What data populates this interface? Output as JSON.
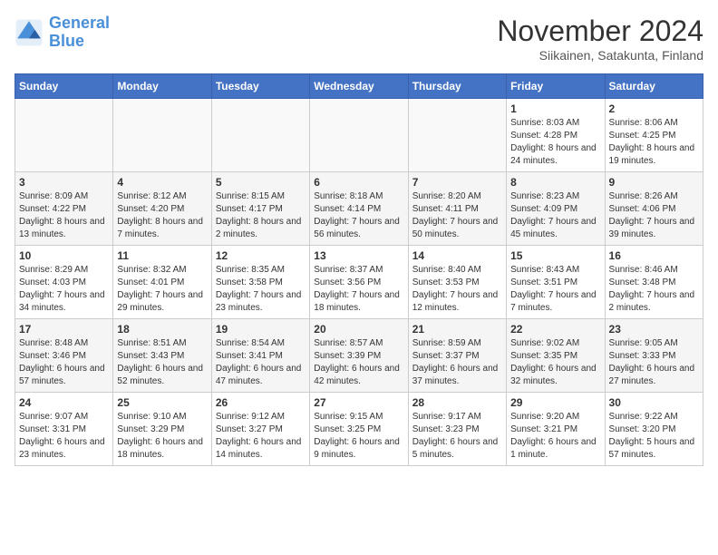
{
  "logo": {
    "line1": "General",
    "line2": "Blue"
  },
  "title": "November 2024",
  "subtitle": "Siikainen, Satakunta, Finland",
  "days_of_week": [
    "Sunday",
    "Monday",
    "Tuesday",
    "Wednesday",
    "Thursday",
    "Friday",
    "Saturday"
  ],
  "weeks": [
    [
      {
        "day": "",
        "info": ""
      },
      {
        "day": "",
        "info": ""
      },
      {
        "day": "",
        "info": ""
      },
      {
        "day": "",
        "info": ""
      },
      {
        "day": "",
        "info": ""
      },
      {
        "day": "1",
        "info": "Sunrise: 8:03 AM\nSunset: 4:28 PM\nDaylight: 8 hours and 24 minutes."
      },
      {
        "day": "2",
        "info": "Sunrise: 8:06 AM\nSunset: 4:25 PM\nDaylight: 8 hours and 19 minutes."
      }
    ],
    [
      {
        "day": "3",
        "info": "Sunrise: 8:09 AM\nSunset: 4:22 PM\nDaylight: 8 hours and 13 minutes."
      },
      {
        "day": "4",
        "info": "Sunrise: 8:12 AM\nSunset: 4:20 PM\nDaylight: 8 hours and 7 minutes."
      },
      {
        "day": "5",
        "info": "Sunrise: 8:15 AM\nSunset: 4:17 PM\nDaylight: 8 hours and 2 minutes."
      },
      {
        "day": "6",
        "info": "Sunrise: 8:18 AM\nSunset: 4:14 PM\nDaylight: 7 hours and 56 minutes."
      },
      {
        "day": "7",
        "info": "Sunrise: 8:20 AM\nSunset: 4:11 PM\nDaylight: 7 hours and 50 minutes."
      },
      {
        "day": "8",
        "info": "Sunrise: 8:23 AM\nSunset: 4:09 PM\nDaylight: 7 hours and 45 minutes."
      },
      {
        "day": "9",
        "info": "Sunrise: 8:26 AM\nSunset: 4:06 PM\nDaylight: 7 hours and 39 minutes."
      }
    ],
    [
      {
        "day": "10",
        "info": "Sunrise: 8:29 AM\nSunset: 4:03 PM\nDaylight: 7 hours and 34 minutes."
      },
      {
        "day": "11",
        "info": "Sunrise: 8:32 AM\nSunset: 4:01 PM\nDaylight: 7 hours and 29 minutes."
      },
      {
        "day": "12",
        "info": "Sunrise: 8:35 AM\nSunset: 3:58 PM\nDaylight: 7 hours and 23 minutes."
      },
      {
        "day": "13",
        "info": "Sunrise: 8:37 AM\nSunset: 3:56 PM\nDaylight: 7 hours and 18 minutes."
      },
      {
        "day": "14",
        "info": "Sunrise: 8:40 AM\nSunset: 3:53 PM\nDaylight: 7 hours and 12 minutes."
      },
      {
        "day": "15",
        "info": "Sunrise: 8:43 AM\nSunset: 3:51 PM\nDaylight: 7 hours and 7 minutes."
      },
      {
        "day": "16",
        "info": "Sunrise: 8:46 AM\nSunset: 3:48 PM\nDaylight: 7 hours and 2 minutes."
      }
    ],
    [
      {
        "day": "17",
        "info": "Sunrise: 8:48 AM\nSunset: 3:46 PM\nDaylight: 6 hours and 57 minutes."
      },
      {
        "day": "18",
        "info": "Sunrise: 8:51 AM\nSunset: 3:43 PM\nDaylight: 6 hours and 52 minutes."
      },
      {
        "day": "19",
        "info": "Sunrise: 8:54 AM\nSunset: 3:41 PM\nDaylight: 6 hours and 47 minutes."
      },
      {
        "day": "20",
        "info": "Sunrise: 8:57 AM\nSunset: 3:39 PM\nDaylight: 6 hours and 42 minutes."
      },
      {
        "day": "21",
        "info": "Sunrise: 8:59 AM\nSunset: 3:37 PM\nDaylight: 6 hours and 37 minutes."
      },
      {
        "day": "22",
        "info": "Sunrise: 9:02 AM\nSunset: 3:35 PM\nDaylight: 6 hours and 32 minutes."
      },
      {
        "day": "23",
        "info": "Sunrise: 9:05 AM\nSunset: 3:33 PM\nDaylight: 6 hours and 27 minutes."
      }
    ],
    [
      {
        "day": "24",
        "info": "Sunrise: 9:07 AM\nSunset: 3:31 PM\nDaylight: 6 hours and 23 minutes."
      },
      {
        "day": "25",
        "info": "Sunrise: 9:10 AM\nSunset: 3:29 PM\nDaylight: 6 hours and 18 minutes."
      },
      {
        "day": "26",
        "info": "Sunrise: 9:12 AM\nSunset: 3:27 PM\nDaylight: 6 hours and 14 minutes."
      },
      {
        "day": "27",
        "info": "Sunrise: 9:15 AM\nSunset: 3:25 PM\nDaylight: 6 hours and 9 minutes."
      },
      {
        "day": "28",
        "info": "Sunrise: 9:17 AM\nSunset: 3:23 PM\nDaylight: 6 hours and 5 minutes."
      },
      {
        "day": "29",
        "info": "Sunrise: 9:20 AM\nSunset: 3:21 PM\nDaylight: 6 hours and 1 minute."
      },
      {
        "day": "30",
        "info": "Sunrise: 9:22 AM\nSunset: 3:20 PM\nDaylight: 5 hours and 57 minutes."
      }
    ]
  ]
}
